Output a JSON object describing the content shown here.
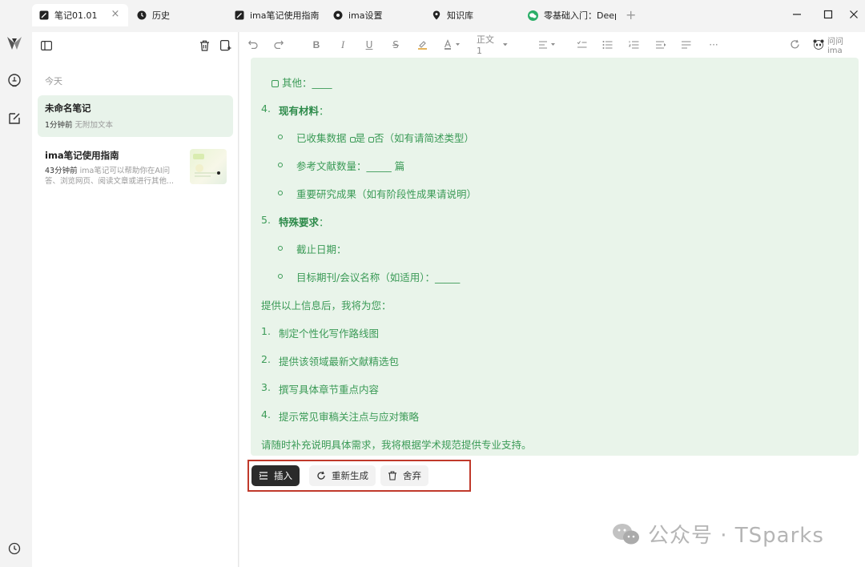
{
  "tabs": [
    {
      "label": "笔记01.01",
      "icon": "note-icon",
      "active": true
    },
    {
      "label": "历史",
      "icon": "clock-icon"
    },
    {
      "label": "ima笔记使用指南",
      "icon": "note-icon"
    },
    {
      "label": "ima设置",
      "icon": "gear-icon"
    },
    {
      "label": "知识库",
      "icon": "location-icon"
    },
    {
      "label": "零基础入门：Deep",
      "icon": "wechat-icon"
    }
  ],
  "notes_panel": {
    "section_label": "今天",
    "notes": [
      {
        "title": "未命名笔记",
        "time": "1分钟前",
        "preview": "无附加文本"
      },
      {
        "title": "ima笔记使用指南",
        "time": "43分钟前",
        "preview_line1": "ima笔记可以帮助你在AI问",
        "preview_line2": "答、浏览网页、阅读文章或进行其他..."
      }
    ]
  },
  "toolbar": {
    "paragraph_style": "正文1",
    "ask_ima": "问问ima"
  },
  "content": {
    "other_line": "其他：____",
    "item4_num": "4.",
    "item4_title": "现有材料",
    "item4_colon": "：",
    "item4_sub1_a": "已收集数据",
    "item4_sub1_b": "是",
    "item4_sub1_c": "否（如有请简述类型）",
    "item4_sub2": "参考文献数量：_____ 篇",
    "item4_sub3": "重要研究成果（如有阶段性成果请说明）",
    "item5_num": "5.",
    "item5_title": "特殊要求",
    "item5_colon": "：",
    "item5_sub1": "截止日期：",
    "item5_sub2": "目标期刊/会议名称（如适用）：_____",
    "after_intro": "提供以上信息后，我将为您：",
    "steps": [
      {
        "num": "1.",
        "text": "制定个性化写作路线图"
      },
      {
        "num": "2.",
        "text": "提供该领域最新文献精选包"
      },
      {
        "num": "3.",
        "text": "撰写具体章节重点内容"
      },
      {
        "num": "4.",
        "text": "提示常见审稿关注点与应对策略"
      }
    ],
    "closing": "请随时补充说明具体需求，我将根据学术规范提供专业支持。"
  },
  "actions": {
    "insert": "插入",
    "regenerate": "重新生成",
    "discard": "舍弃"
  },
  "watermark": "公众号 · TSparks",
  "colors": {
    "ai_green_text": "#3a9a56",
    "ai_box_bg": "#e9f4ea",
    "selected_note_bg": "#e8f3ea",
    "highlight_border": "#c0392b"
  }
}
